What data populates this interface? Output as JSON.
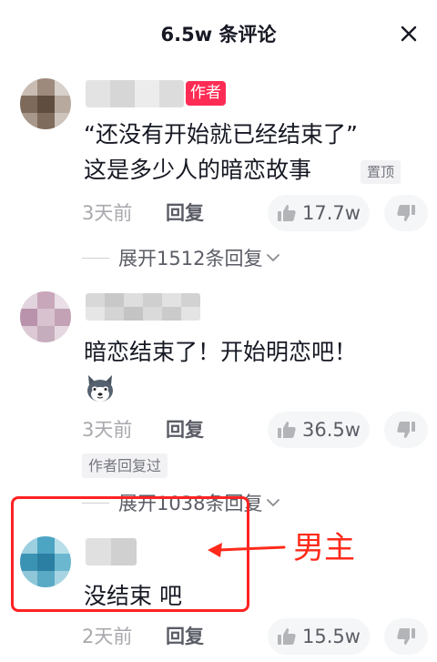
{
  "header": {
    "title": "6.5w 条评论"
  },
  "comments": [
    {
      "author_tag": "作者",
      "text_line1": "“还没有开始就已经结束了”",
      "text_line2": "这是多少人的暗恋故事",
      "pin_label": "置顶",
      "time": "3天前",
      "reply_label": "回复",
      "likes": "17.7w",
      "expand_label": "展开1512条回复"
    },
    {
      "text_line1": "暗恋结束了！开始明恋吧！",
      "emoji_icon": "husky-dog-emoji",
      "time": "3天前",
      "reply_label": "回复",
      "likes": "36.5w",
      "author_replied_label": "作者回复过",
      "expand_label": "展开1038条回复"
    },
    {
      "text_line1": "没结束 吧",
      "time": "2天前",
      "reply_label": "回复",
      "likes": "15.5w"
    }
  ],
  "annotation": {
    "label": "男主",
    "color": "#ff2a1a"
  },
  "colors": {
    "author_tag": "#fe2c55",
    "muted": "#a8a9ae",
    "highlight": "#ff2222"
  }
}
